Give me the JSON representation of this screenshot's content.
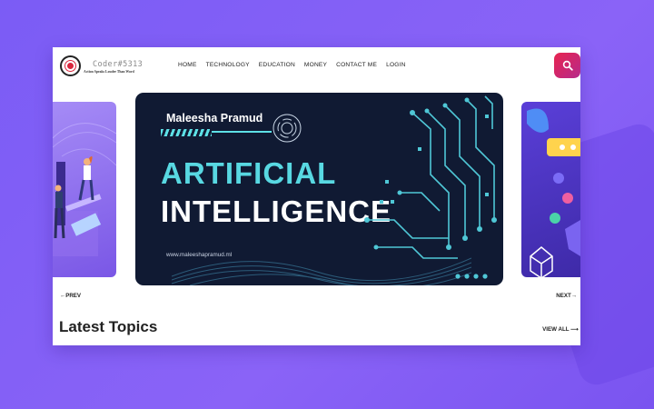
{
  "header": {
    "brand": "Coder#5313",
    "tagline": "Action Speaks Louder Than Word",
    "nav": [
      "HOME",
      "TECHNOLOGY",
      "EDUCATION",
      "MONEY",
      "CONTACT ME",
      "LOGIN"
    ]
  },
  "icons": {
    "search": "search-icon",
    "logo": "logo-icon"
  },
  "colors": {
    "accent_cyan": "#58d8e2",
    "search_gradient_start": "#e8244f",
    "search_gradient_end": "#b52a8c",
    "background": "#7b5cf5"
  },
  "carousel": {
    "slide": {
      "author": "Maleesha Pramud",
      "headline_line1": "ARTIFICIAL",
      "headline_line2": "INTELLIGENCE",
      "url": "www.maleeshapramud.ml"
    },
    "prev_label": "PREV",
    "next_label": "NEXT"
  },
  "section": {
    "title": "Latest Topics",
    "view_all": "VIEW ALL"
  }
}
